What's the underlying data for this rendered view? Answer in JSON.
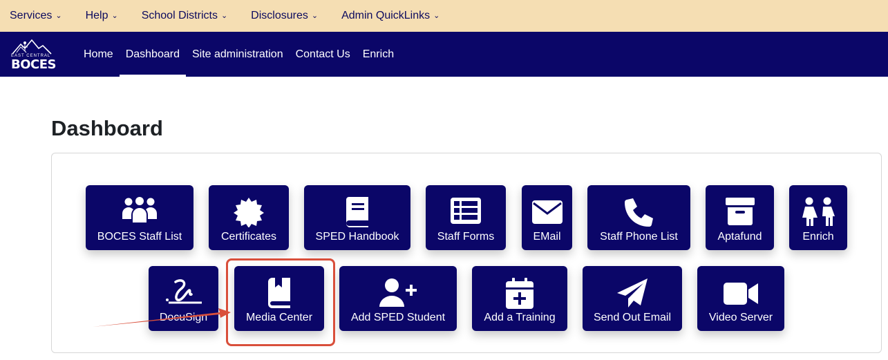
{
  "topbar": {
    "menus": [
      "Services",
      "Help",
      "School Districts",
      "Disclosures",
      "Admin QuickLinks"
    ]
  },
  "navbar": {
    "logo": {
      "line1": "EAST CENTRAL",
      "line2": "BOCES"
    },
    "links": [
      "Home",
      "Dashboard",
      "Site administration",
      "Contact Us",
      "Enrich"
    ],
    "active": "Dashboard"
  },
  "page": {
    "title": "Dashboard"
  },
  "tiles": [
    {
      "label": "BOCES Staff List",
      "icon": "people-group-icon"
    },
    {
      "label": "Certificates",
      "icon": "certificate-icon"
    },
    {
      "label": "SPED Handbook",
      "icon": "book-icon"
    },
    {
      "label": "Staff Forms",
      "icon": "table-list-icon"
    },
    {
      "label": "EMail",
      "icon": "envelope-icon"
    },
    {
      "label": "Staff Phone List",
      "icon": "phone-icon"
    },
    {
      "label": "Aptafund",
      "icon": "archive-box-icon"
    },
    {
      "label": "Enrich",
      "icon": "children-icon"
    },
    {
      "label": "DocuSign",
      "icon": "signature-icon"
    },
    {
      "label": "Media Center",
      "icon": "book-bookmark-icon"
    },
    {
      "label": "Add SPED Student",
      "icon": "user-plus-icon"
    },
    {
      "label": "Add a Training",
      "icon": "calendar-plus-icon"
    },
    {
      "label": "Send Out Email",
      "icon": "paper-plane-icon"
    },
    {
      "label": "Video Server",
      "icon": "video-camera-icon"
    }
  ],
  "annotation": {
    "highlighted_tile": "Media Center",
    "arrow_color": "#d94f3b"
  },
  "colors": {
    "brand_navy": "#0b0668",
    "topbar_bg": "#f5deb3"
  }
}
